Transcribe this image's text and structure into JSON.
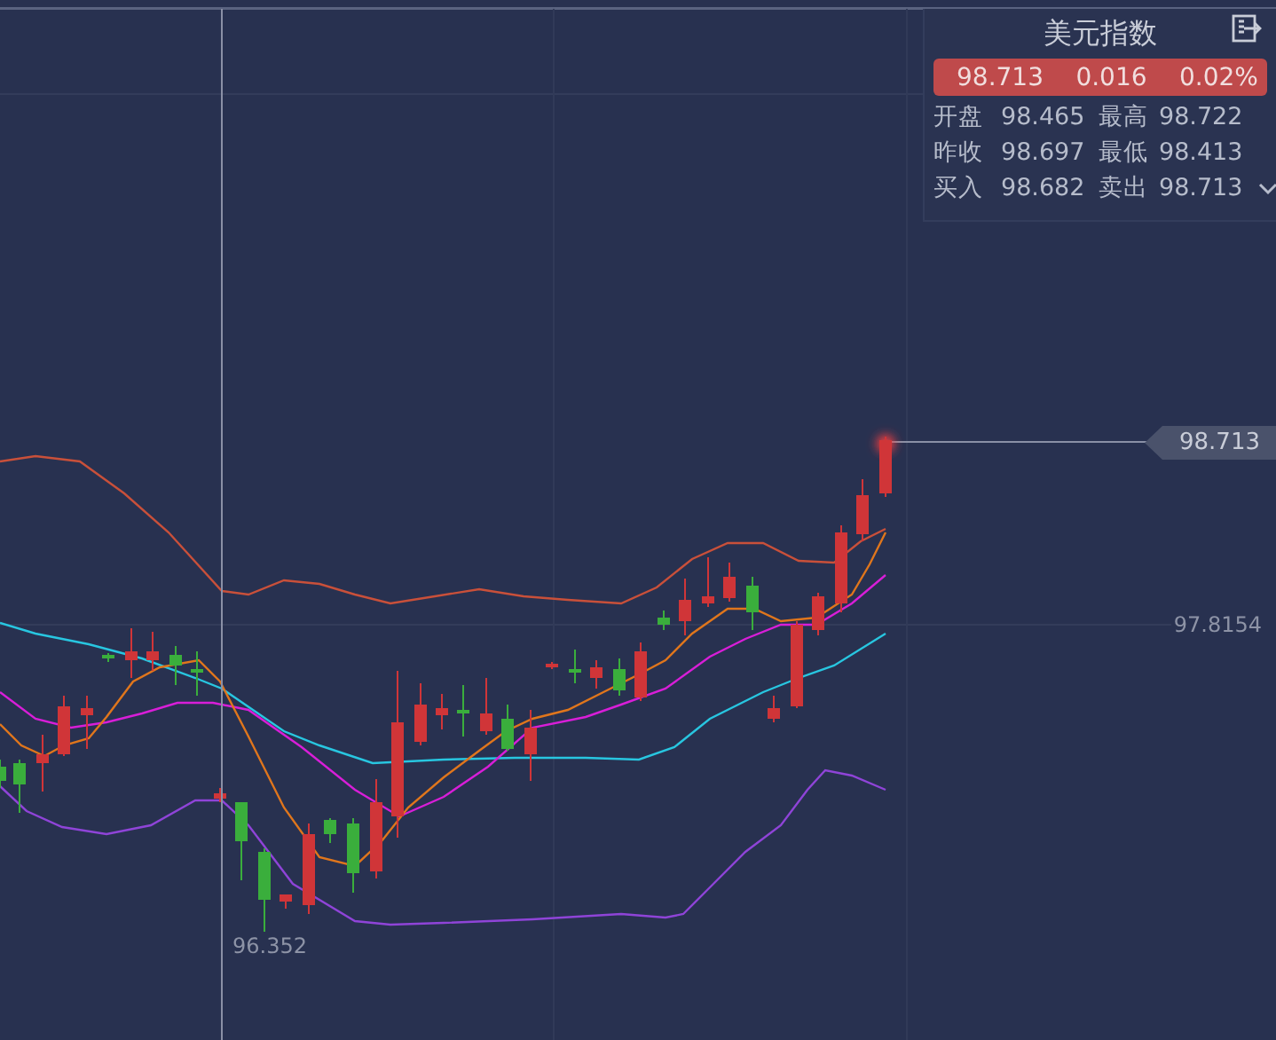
{
  "quote_panel": {
    "title": "美元指数",
    "rising": true,
    "last": "98.713",
    "change": "0.016",
    "change_percent": "0.02%",
    "stats": [
      {
        "label": "开盘",
        "value": "98.465"
      },
      {
        "label": "最高",
        "value": "98.722"
      },
      {
        "label": "昨收",
        "value": "98.697"
      },
      {
        "label": "最低",
        "value": "98.413"
      },
      {
        "label": "买入",
        "value": "98.682"
      },
      {
        "label": "卖出",
        "value": "98.713"
      }
    ]
  },
  "chart": {
    "current_price_tag": "98.713",
    "mid_price_label": "97.8154",
    "low_price_label": "96.352"
  }
}
